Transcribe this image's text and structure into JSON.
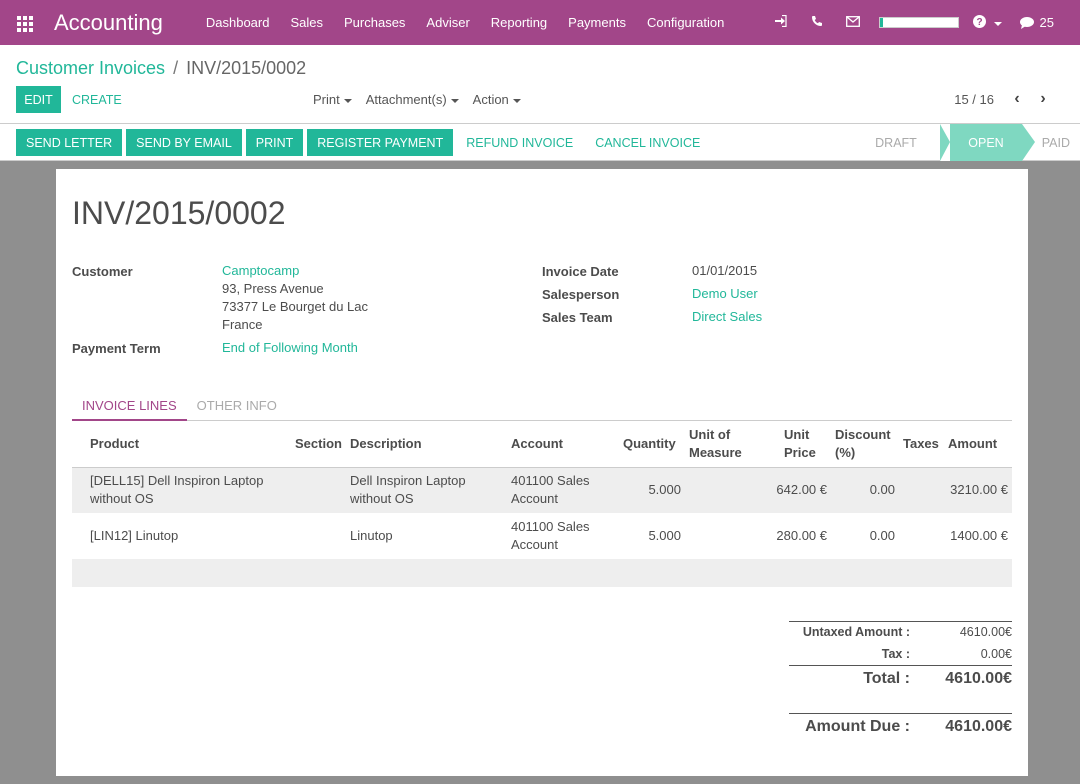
{
  "app": {
    "title": "Accounting",
    "menu": [
      "Dashboard",
      "Sales",
      "Purchases",
      "Adviser",
      "Reporting",
      "Payments",
      "Configuration"
    ],
    "progress_percent": 4,
    "messages_count": "25",
    "icons": [
      "apps-grid-icon",
      "sign-in-icon",
      "phone-icon",
      "envelope-icon",
      "help-icon",
      "chat-icon"
    ]
  },
  "breadcrumb": {
    "parent": "Customer Invoices",
    "separator": "/",
    "current": "INV/2015/0002"
  },
  "controls": {
    "edit": "Edit",
    "create": "Create",
    "print": "Print",
    "attachments": "Attachment(s)",
    "action": "Action",
    "pager": "15 / 16"
  },
  "statusbar": {
    "buttons": [
      "Send Letter",
      "Send by Email",
      "Print",
      "Register Payment"
    ],
    "links": [
      "Refund Invoice",
      "Cancel Invoice"
    ],
    "stages": [
      "Draft",
      "Open",
      "Paid"
    ],
    "active_stage": "Open"
  },
  "invoice": {
    "number": "INV/2015/0002",
    "customer_label": "Customer",
    "customer_name": "Camptocamp",
    "address": [
      "93, Press Avenue",
      "73377 Le Bourget du Lac",
      "France"
    ],
    "payment_term_label": "Payment Term",
    "payment_term": "End of Following Month",
    "invoice_date_label": "Invoice Date",
    "invoice_date": "01/01/2015",
    "salesperson_label": "Salesperson",
    "salesperson": "Demo User",
    "sales_team_label": "Sales Team",
    "sales_team": "Direct Sales"
  },
  "tabs": [
    "Invoice Lines",
    "Other Info"
  ],
  "lines": {
    "headers": [
      "Product",
      "Section",
      "Description",
      "Account",
      "Quantity",
      "Unit of Measure",
      "Unit Price",
      "Discount (%)",
      "Taxes",
      "Amount"
    ],
    "rows": [
      {
        "product": "[DELL15] Dell Inspiron Laptop without OS",
        "section": "",
        "description": "Dell Inspiron Laptop without OS",
        "account": "401100 Sales Account",
        "quantity": "5.000",
        "uom": "",
        "unit_price": "642.00 €",
        "discount": "0.00",
        "taxes": "",
        "amount": "3210.00 €"
      },
      {
        "product": "[LIN12] Linutop",
        "section": "",
        "description": "Linutop",
        "account": "401100 Sales Account",
        "quantity": "5.000",
        "uom": "",
        "unit_price": "280.00 €",
        "discount": "0.00",
        "taxes": "",
        "amount": "1400.00 €"
      }
    ]
  },
  "totals": {
    "untaxed_label": "Untaxed Amount :",
    "untaxed": "4610.00€",
    "tax_label": "Tax :",
    "tax": "0.00€",
    "total_label": "Total :",
    "total": "4610.00€",
    "due_label": "Amount Due :",
    "due": "4610.00€"
  },
  "colors": {
    "navbar": "#a24689",
    "accent": "#21b799",
    "stage_active": "#7fd8c1",
    "background": "#8f8f8f"
  }
}
